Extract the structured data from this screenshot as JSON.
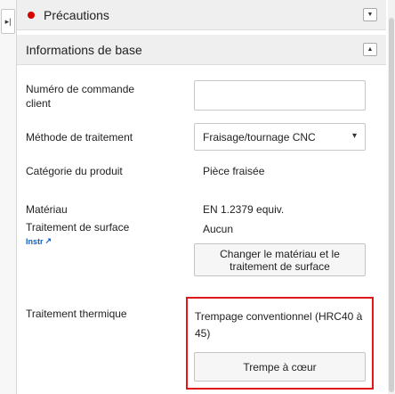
{
  "panel": {
    "toggle_icon": "collapse-right-icon",
    "precautions": {
      "title": "Précautions",
      "status_color": "#d50000",
      "toggle_icon": "chevron-down-icon"
    },
    "basic_info": {
      "title": "Informations de base",
      "toggle_icon": "chevron-up-icon"
    }
  },
  "fields": {
    "customer_order": {
      "label": "Numéro de commande client",
      "value": ""
    },
    "processing_method": {
      "label": "Méthode de traitement",
      "value": "Fraisage/tournage CNC"
    },
    "product_category": {
      "label": "Catégorie du produit",
      "value": "Pièce fraisée"
    },
    "material": {
      "label": "Matériau",
      "value": "EN 1.2379 equiv."
    },
    "surface_treatment": {
      "label": "Traitement de surface",
      "value": "Aucun",
      "instr_link": "Instr"
    },
    "change_button": "Changer le matériau et le traitement de surface",
    "heat_treatment": {
      "label": "Traitement thermique",
      "value": "Trempage conventionnel (HRC40 à 45)",
      "button": "Trempe à cœur"
    }
  }
}
